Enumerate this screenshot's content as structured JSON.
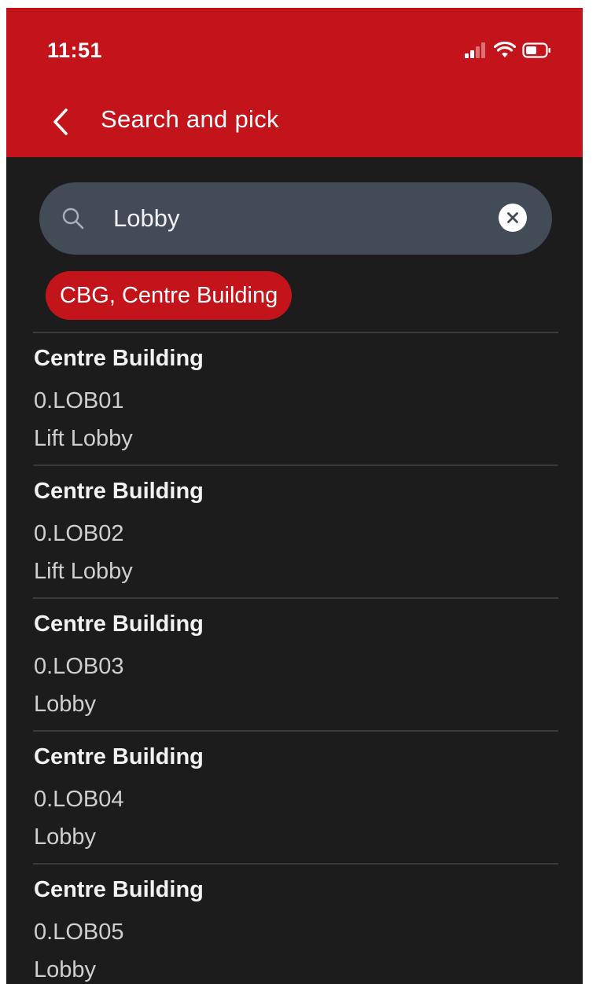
{
  "status_bar": {
    "time": "11:51",
    "icons": [
      "signal-icon",
      "wifi-icon",
      "battery-icon"
    ]
  },
  "header": {
    "back_icon": "chevron-left-icon",
    "title": "Search and pick",
    "background_color": "#c2141a"
  },
  "search": {
    "value": "Lobby",
    "icon": "search-icon",
    "clear_icon": "clear-icon"
  },
  "filter_chip": {
    "label": "CBG, Centre Building"
  },
  "results": [
    {
      "building": "Centre Building",
      "code": "0.LOB01",
      "name": "Lift Lobby"
    },
    {
      "building": "Centre Building",
      "code": "0.LOB02",
      "name": "Lift Lobby"
    },
    {
      "building": "Centre Building",
      "code": "0.LOB03",
      "name": "Lobby"
    },
    {
      "building": "Centre Building",
      "code": "0.LOB04",
      "name": "Lobby"
    },
    {
      "building": "Centre Building",
      "code": "0.LOB05",
      "name": "Lobby"
    }
  ],
  "colors": {
    "accent": "#c2141a",
    "background": "#1c1c1d",
    "search_field": "#434b56"
  }
}
